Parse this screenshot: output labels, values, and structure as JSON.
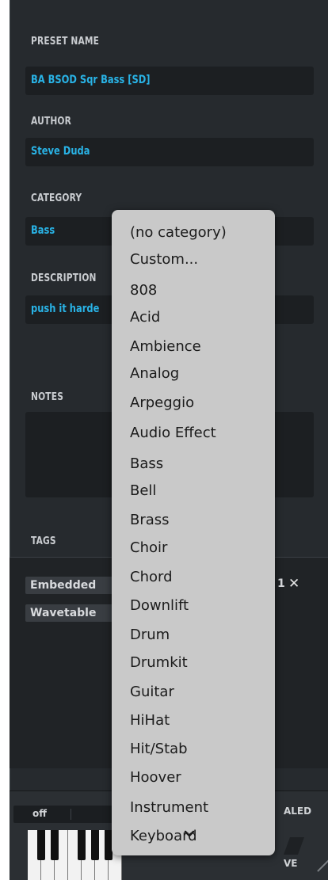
{
  "preset_name": {
    "label": "PRESET NAME",
    "value": "BA BSOD Sqr Bass [SD]"
  },
  "author": {
    "label": "AUTHOR",
    "value": "Steve Duda"
  },
  "category": {
    "label": "CATEGORY",
    "value": "Bass"
  },
  "description": {
    "label": "DESCRIPTION",
    "value": "push it harde"
  },
  "notes": {
    "label": "NOTES",
    "value": ""
  },
  "tags": {
    "label": "TAGS",
    "items": [
      "Embedded",
      "Wavetable"
    ],
    "partial_text": "1"
  },
  "bottom": {
    "mode_value": "off",
    "scaled_label": "ALED",
    "ve_label": "VE"
  },
  "menu": {
    "items": [
      "(no category)",
      "Custom...",
      "808",
      "Acid",
      "Ambience",
      "Analog",
      "Arpeggio",
      "Audio Effect",
      "Bass",
      "Bell",
      "Brass",
      "Choir",
      "Chord",
      "Downlift",
      "Drum",
      "Drumkit",
      "Guitar",
      "HiHat",
      "Hit/Stab",
      "Hoover",
      "Instrument",
      "Keyboard"
    ],
    "more_icon": "chevron-down-icon"
  },
  "colors": {
    "accent": "#29b3e6",
    "panel": "#262a2e",
    "field": "#1c1f22",
    "menu_bg": "#c9c9c9"
  }
}
